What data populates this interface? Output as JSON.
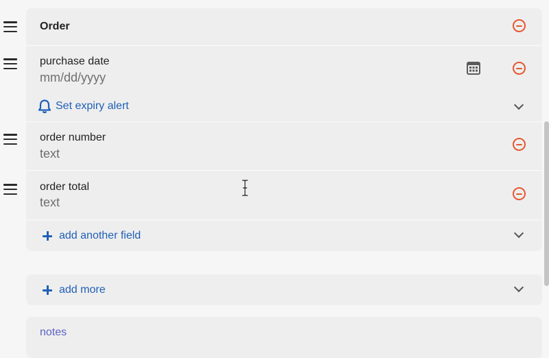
{
  "section": {
    "title": "Order",
    "fields": [
      {
        "label": "purchase date",
        "value": "mm/dd/yyyy"
      },
      {
        "label": "order number",
        "value": "text"
      },
      {
        "label": "order total",
        "value": "text"
      }
    ],
    "expiry_alert": "Set expiry alert",
    "add_field": "add another field"
  },
  "add_more": "add more",
  "next_section": "notes",
  "colors": {
    "accent": "#1f5fb6",
    "remove": "#e4572e",
    "card": "#eeeeee",
    "background": "#f6f6f6"
  },
  "icons": {
    "drag": "drag-handle-icon",
    "remove": "remove-circle-icon",
    "calendar": "calendar-icon",
    "bell": "bell-icon",
    "chevron": "chevron-down-icon",
    "plus": "plus-icon"
  }
}
